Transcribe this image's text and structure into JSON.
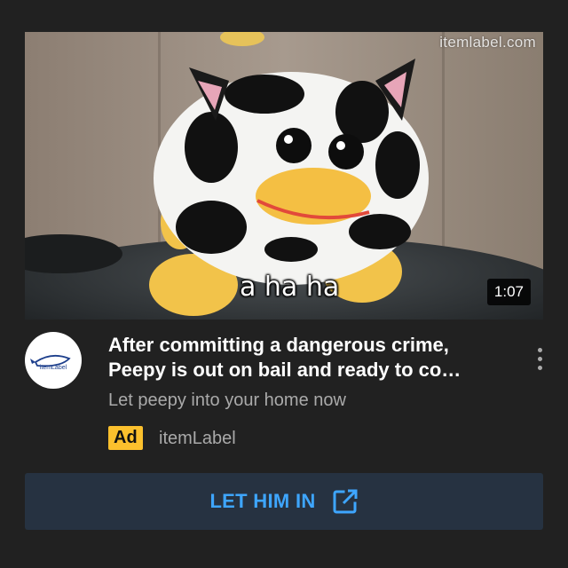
{
  "video": {
    "watermark": "itemlabel.com",
    "caption": "a ha ha",
    "duration": "1:07"
  },
  "ad": {
    "avatar_text": "itemLabel",
    "title": "After committing a dangerous crime,\nPeepy is out on bail and ready to co…",
    "subtitle": "Let peepy into your home now",
    "badge": "Ad",
    "advertiser": "itemLabel",
    "menu_icon": "more-vert-icon"
  },
  "cta": {
    "label": "LET HIM IN",
    "icon": "open-external-icon"
  },
  "colors": {
    "background": "#212121",
    "accent": "#3ea6ff",
    "badge": "#fbc02d",
    "cta_background": "#263241",
    "secondary_text": "#aaaaaa"
  }
}
